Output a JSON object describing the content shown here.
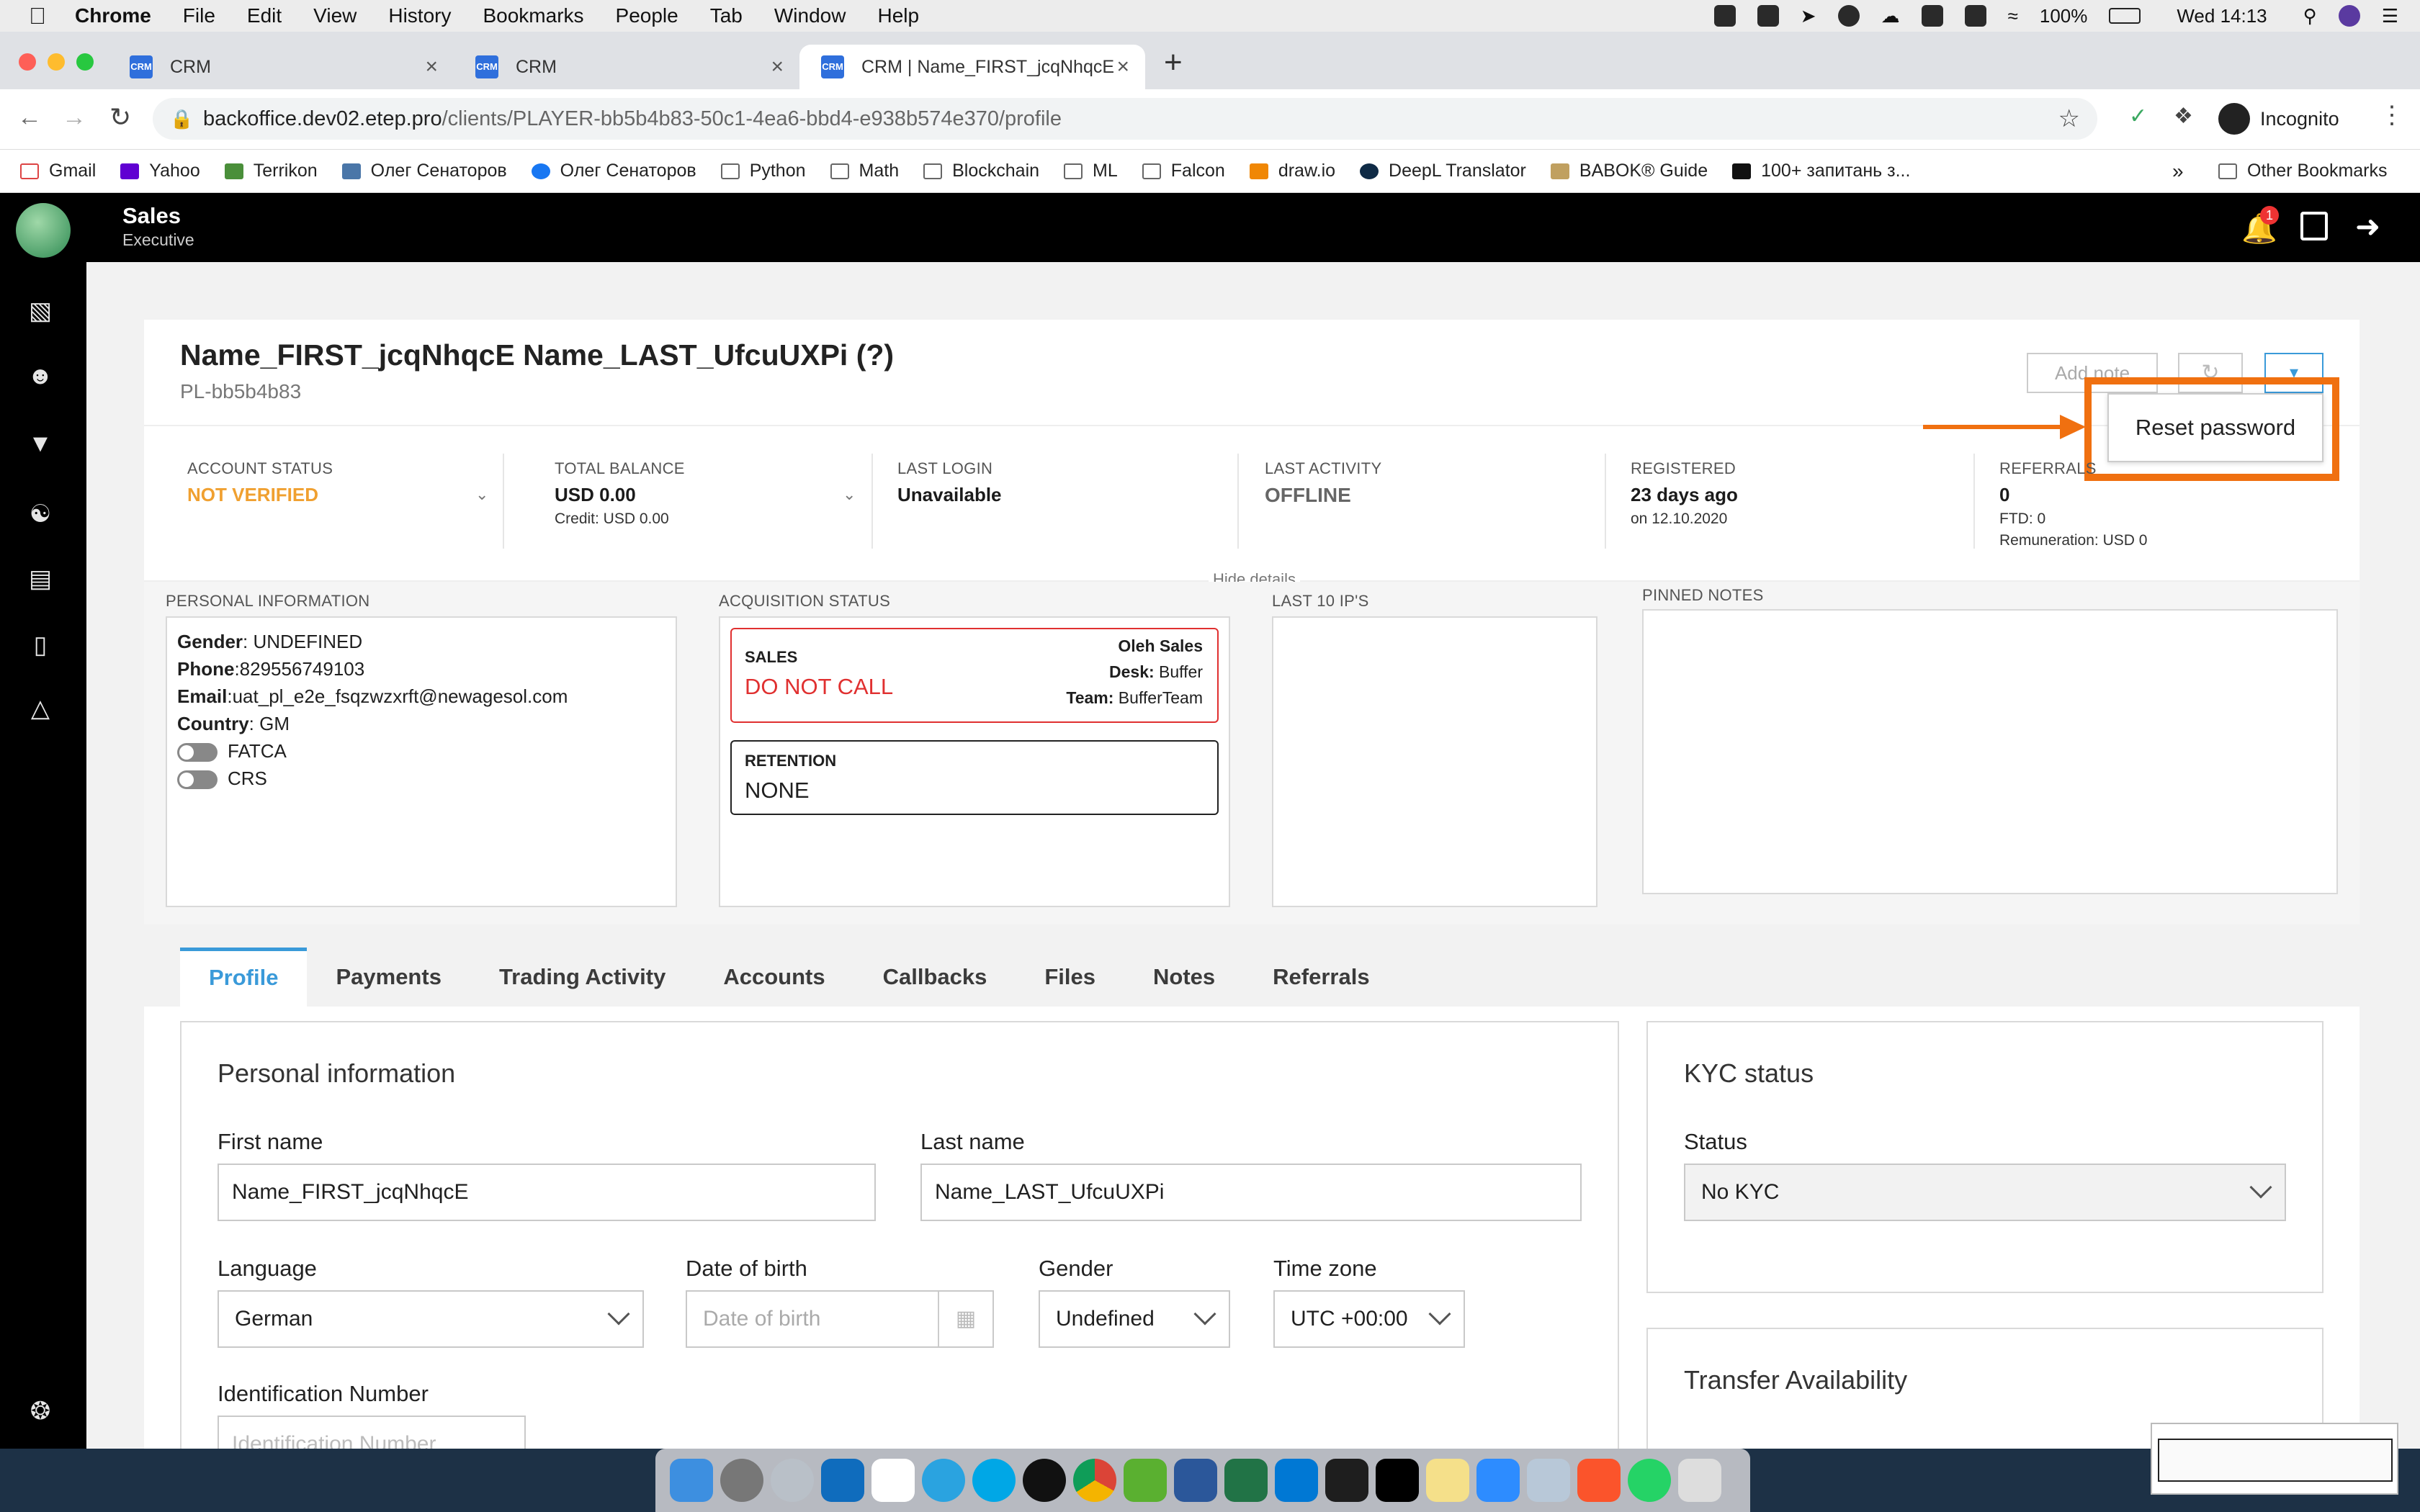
{
  "menubar": {
    "app": "Chrome",
    "items": [
      "File",
      "Edit",
      "View",
      "History",
      "Bookmarks",
      "People",
      "Tab",
      "Window",
      "Help"
    ],
    "battery": "100%",
    "clock": "Wed 14:13"
  },
  "tabs": [
    {
      "label": "CRM"
    },
    {
      "label": "CRM"
    },
    {
      "label": "CRM | Name_FIRST_jcqNhqcE"
    }
  ],
  "urlbar": {
    "host": "backoffice.dev02.etep.pro",
    "path": "/clients/PLAYER-bb5b4b83-50c1-4ea6-bbd4-e938b574e370/profile",
    "profile": "Incognito"
  },
  "bookmarks": [
    "Gmail",
    "Yahoo",
    "Terrikon",
    "Олег Сенаторов",
    "Олег Сенаторов",
    "Python",
    "Math",
    "Blockchain",
    "ML",
    "Falcon",
    "draw.io",
    "DeepL Translator",
    "BABOK® Guide",
    "100+ запитань з..."
  ],
  "bookmarks_other": "Other Bookmarks",
  "app_header": {
    "title": "Sales",
    "subtitle": "Executive",
    "notif_count": "1"
  },
  "client": {
    "name": "Name_FIRST_jcqNhqcE Name_LAST_UfcuUXPi (?)",
    "id": "PL-bb5b4b83"
  },
  "actions": {
    "add_note": "Add note",
    "reset_password": "Reset password"
  },
  "stats": {
    "account_status_label": "ACCOUNT STATUS",
    "account_status": "NOT VERIFIED",
    "total_balance_label": "TOTAL BALANCE",
    "total_balance": "USD 0.00",
    "credit": "Credit: USD 0.00",
    "last_login_label": "LAST LOGIN",
    "last_login": "Unavailable",
    "last_activity_label": "LAST ACTIVITY",
    "last_activity": "OFFLINE",
    "registered_label": "REGISTERED",
    "registered": "23 days ago",
    "registered_on": "on 12.10.2020",
    "referrals_label": "REFERRALS",
    "referrals": "0",
    "ftd": "FTD: 0",
    "remuneration": "Remuneration: USD 0"
  },
  "hide_details": "Hide details",
  "personal": {
    "title": "PERSONAL INFORMATION",
    "gender_k": "Gender",
    "gender_v": ": UNDEFINED",
    "phone_k": "Phone",
    "phone_v": ":829556749103",
    "email_k": "Email",
    "email_v": ":uat_pl_e2e_fsqzwzxrft@newagesol.com",
    "country_k": "Country",
    "country_v": ": GM",
    "fatca": "FATCA",
    "crs": "CRS"
  },
  "acquisition": {
    "title": "ACQUISITION STATUS",
    "sales_label": "SALES",
    "sales_status": "DO NOT CALL",
    "sales_agent": "Oleh Sales",
    "desk_k": "Desk:",
    "desk_v": " Buffer",
    "team_k": "Team:",
    "team_v": " BufferTeam",
    "retention_label": "RETENTION",
    "retention_status": "NONE"
  },
  "ips_title": "LAST 10 IP'S",
  "pinned_title": "PINNED NOTES",
  "nav_tabs": [
    "Profile",
    "Payments",
    "Trading Activity",
    "Accounts",
    "Callbacks",
    "Files",
    "Notes",
    "Referrals"
  ],
  "profile_form": {
    "title": "Personal information",
    "first_name_label": "First name",
    "first_name": "Name_FIRST_jcqNhqcE",
    "last_name_label": "Last name",
    "last_name": "Name_LAST_UfcuUXPi",
    "language_label": "Language",
    "language": "German",
    "dob_label": "Date of birth",
    "dob_placeholder": "Date of birth",
    "gender_label": "Gender",
    "gender": "Undefined",
    "timezone_label": "Time zone",
    "timezone": "UTC +00:00",
    "idnum_label": "Identification Number",
    "idnum_placeholder": "Identification Number"
  },
  "kyc": {
    "title": "KYC status",
    "status_label": "Status",
    "status": "No KYC"
  },
  "transfer": {
    "title": "Transfer Availability"
  },
  "colors": {
    "accent": "#3a9ad9",
    "warning": "#f0a030",
    "danger": "#e03030",
    "annotation": "#f07010"
  }
}
